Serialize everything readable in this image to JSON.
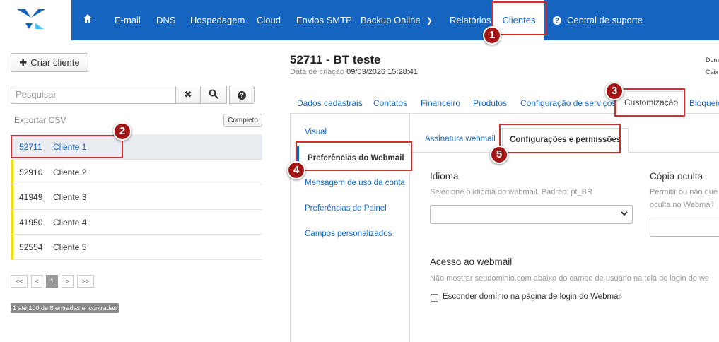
{
  "nav": {
    "items": [
      "E-mail",
      "DNS",
      "Hospedagem",
      "Cloud",
      "Envios SMTP",
      "Backup Online",
      "Relatórios",
      "Clientes",
      "Central de suporte"
    ]
  },
  "left": {
    "create_label": "Criar cliente",
    "search_placeholder": "Pesquisar",
    "export_label": "Exportar CSV",
    "complete_label": "Completo",
    "clients": [
      {
        "id": "52711",
        "name": "Cliente 1"
      },
      {
        "id": "52910",
        "name": "Cliente 2"
      },
      {
        "id": "41949",
        "name": "Cliente 3"
      },
      {
        "id": "41950",
        "name": "Cliente 4"
      },
      {
        "id": "52554",
        "name": "Cliente 5"
      }
    ],
    "pager": [
      "<<",
      "<",
      "1",
      ">",
      ">>"
    ],
    "entries_text": "1 até 100 de 8 entradas encontradas"
  },
  "detail": {
    "title": "52711 - BT teste",
    "created_label": "Data de criação",
    "created_value": "09/03/2026 15:28:41",
    "edge_1": "Dom",
    "edge_2": "Caix",
    "tabs": [
      "Dados cadastrais",
      "Contatos",
      "Financeiro",
      "Produtos",
      "Configuração de serviços",
      "Customização",
      "Bloqueio"
    ],
    "side": [
      "Visual",
      "Preferências do Webmail",
      "Mensagem de uso da conta",
      "Preferências do Painel",
      "Campos personalizados"
    ],
    "subtabs": [
      "Assinatura webmail",
      "Configurações e permissões"
    ],
    "idioma_title": "Idioma",
    "idioma_desc": "Selecione o idioma do webmail. Padrão: pt_BR",
    "copia_title": "Cópia oculta",
    "copia_desc_1": "Permitir ou não que",
    "copia_desc_2": "oculta no Webmail",
    "acesso_title": "Acesso ao webmail",
    "acesso_desc": "Não mostrar seudominio.com abaixo do campo de usuário na tela de login do we",
    "checkbox_label": "Esconder domínio na página de login do Webmail"
  },
  "markers": [
    "1",
    "2",
    "3",
    "4",
    "5"
  ]
}
